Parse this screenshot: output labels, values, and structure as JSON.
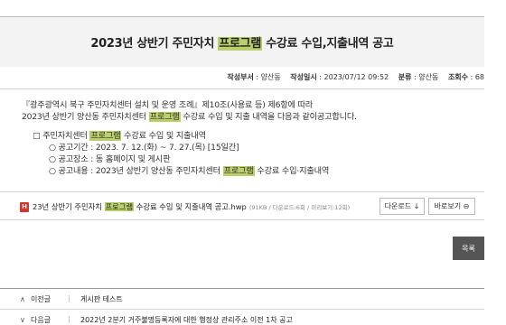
{
  "post": {
    "title_pre": "2023년 상반기 주민자치 ",
    "title_hl": "프로그램",
    "title_post": " 수강료 수입,지출내역 공고",
    "meta": {
      "author_label": "작성부서",
      "author": "양산동",
      "date_label": "작성일시",
      "date": "2023/07/12 09:52",
      "dept_label": "분류",
      "dept": "양산동",
      "views_label": "조회수",
      "views": "68"
    }
  },
  "content": {
    "intro1": "『광주광역시 북구 주민자치센터 설치 및 운영 조례』제10조(사용료 등) 제6항에 따라",
    "intro2_pre": "2023년 상반기 양산동 주민자치센터 ",
    "intro2_hl": "프로그램",
    "intro2_post": " 수강료 수입 및 지출 내역을 다음과 같이공고합니다.",
    "list_title_pre": "□ 주민자치센터 ",
    "list_title_hl": "프로그램",
    "list_title_post": " 수강료 수입 및 지출내역",
    "item1": "○ 공고기간 : 2023. 7. 12.(화) ~ 7. 27.(목) [15일간]",
    "item2": "○ 공고장소 : 동 홈페이지 및 게시판",
    "item3_pre": "○ 공고내용 : 2023년 상반기 양산동 주민자치센터 ",
    "item3_hl": "프로그램",
    "item3_post": " 수강료 수입·지출내역"
  },
  "attachment": {
    "icon_text": "H",
    "name_pre": "23년 상반기 주민자치 ",
    "name_hl": "프로그램",
    "name_post": " 수강료 수입 및 지출내역 공고.hwp",
    "meta": "(91KB / 다운로드:6회 / 미리보기:12회)",
    "download_label": "다운로드 ↓",
    "preview_label": "바로보기 ⊖"
  },
  "buttons": {
    "list_label": "목록"
  },
  "nav": {
    "prev_arrow": "∧",
    "prev_label": "이전글",
    "prev_title": "게시판 테스트",
    "next_arrow": "∨",
    "next_label": "다음글",
    "next_title": "2022년 2분기 거주불명등록자에 대한 행정상 관리주소 이전 1차 공고"
  }
}
